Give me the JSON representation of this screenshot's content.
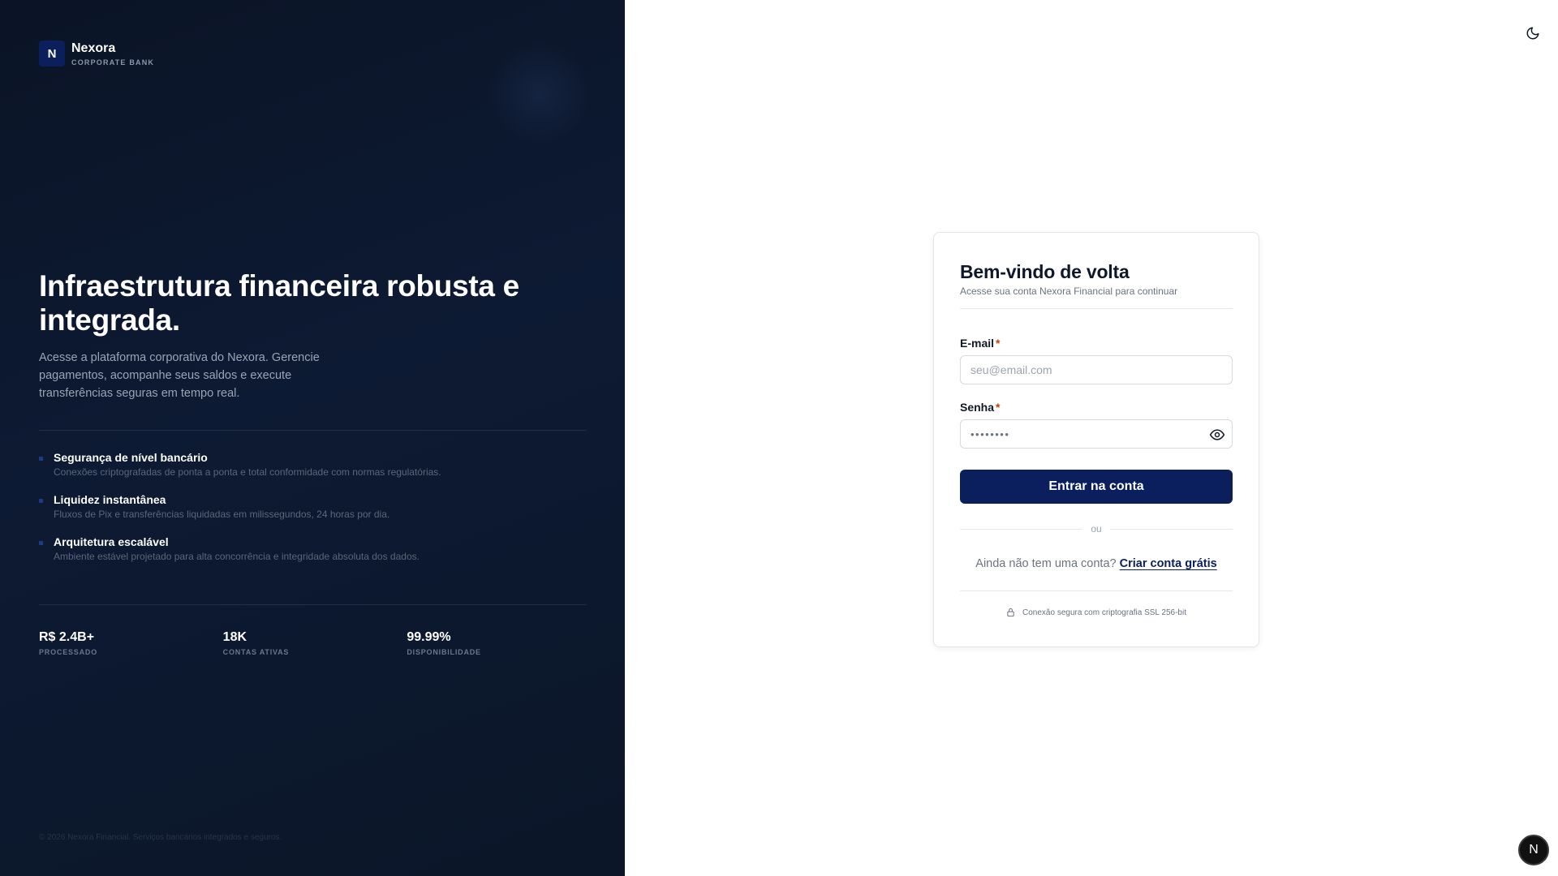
{
  "brand": {
    "logo_letter": "N",
    "name": "Nexora",
    "subtitle": "CORPORATE BANK"
  },
  "hero": {
    "title": "Infraestrutura financeira robusta e integrada.",
    "description": "Acesse a plataforma corporativa do Nexora. Gerencie pagamentos, acompanhe seus saldos e execute transferências seguras em tempo real."
  },
  "features": [
    {
      "title": "Segurança de nível bancário",
      "description": "Conexões criptografadas de ponta a ponta e total conformidade com normas regulatórias."
    },
    {
      "title": "Liquidez instantânea",
      "description": "Fluxos de Pix e transferências liquidadas em milissegundos, 24 horas por dia."
    },
    {
      "title": "Arquitetura escalável",
      "description": "Ambiente estável projetado para alta concorrência e integridade absoluta dos dados."
    }
  ],
  "stats": [
    {
      "value": "R$ 2.4B+",
      "label": "PROCESSADO"
    },
    {
      "value": "18K",
      "label": "CONTAS ATIVAS"
    },
    {
      "value": "99.99%",
      "label": "DISPONIBILIDADE"
    }
  ],
  "footer": {
    "copyright": "© 2026 Nexora Financial. Serviços bancários integrados e seguros."
  },
  "login": {
    "title": "Bem-vindo de volta",
    "subtitle": "Acesse sua conta Nexora Financial para continuar",
    "email_label": "E-mail",
    "email_placeholder": "seu@email.com",
    "password_label": "Senha",
    "password_value": "••••••••",
    "required_mark": "*",
    "submit_label": "Entrar na conta",
    "or_text": "ou",
    "signup_prompt": "Ainda não tem uma conta?",
    "signup_link": "Criar conta grátis",
    "secure_note": "Conexão segura com criptografia SSL 256-bit"
  },
  "icons": {
    "theme_toggle": "moon-icon",
    "password_toggle": "eye-icon",
    "secure": "lock-icon"
  },
  "avatar": {
    "letter": "N"
  },
  "colors": {
    "primary": "#0a1f5c",
    "left_panel_bg": "#0b1426",
    "required": "#c2410c"
  }
}
